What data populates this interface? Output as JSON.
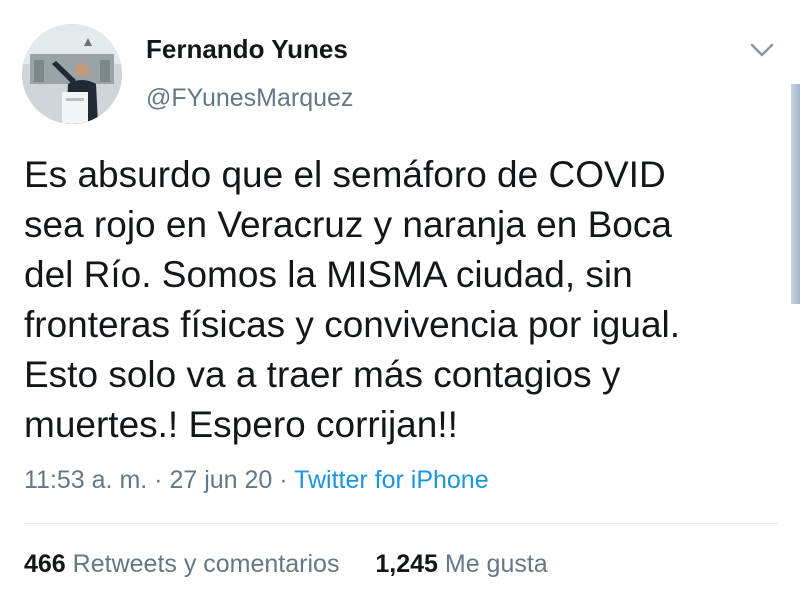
{
  "author": {
    "name": "Fernando Yunes",
    "handle": "@FYunesMarquez"
  },
  "tweet": {
    "text": "Es absurdo que el semáforo de COVID\nsea rojo en Veracruz y naranja en Boca\ndel Río. Somos la MISMA ciudad, sin\nfronteras físicas y convivencia por igual.\nEsto solo va a traer más contagios y\nmuertes.! Espero corrijan!!"
  },
  "meta": {
    "time": "11:53 a. m.",
    "separator": " · ",
    "date": "27 jun 20",
    "source": "Twitter for iPhone"
  },
  "stats": {
    "retweets_count": "466",
    "retweets_label": "Retweets y comentarios",
    "likes_count": "1,245",
    "likes_label": "Me gusta"
  },
  "icons": {
    "menu": "chevron-down-icon",
    "avatar": "profile-photo"
  },
  "colors": {
    "text": "#14171a",
    "secondary": "#657786",
    "link": "#1b95e0",
    "divider": "#e1e8ed"
  }
}
